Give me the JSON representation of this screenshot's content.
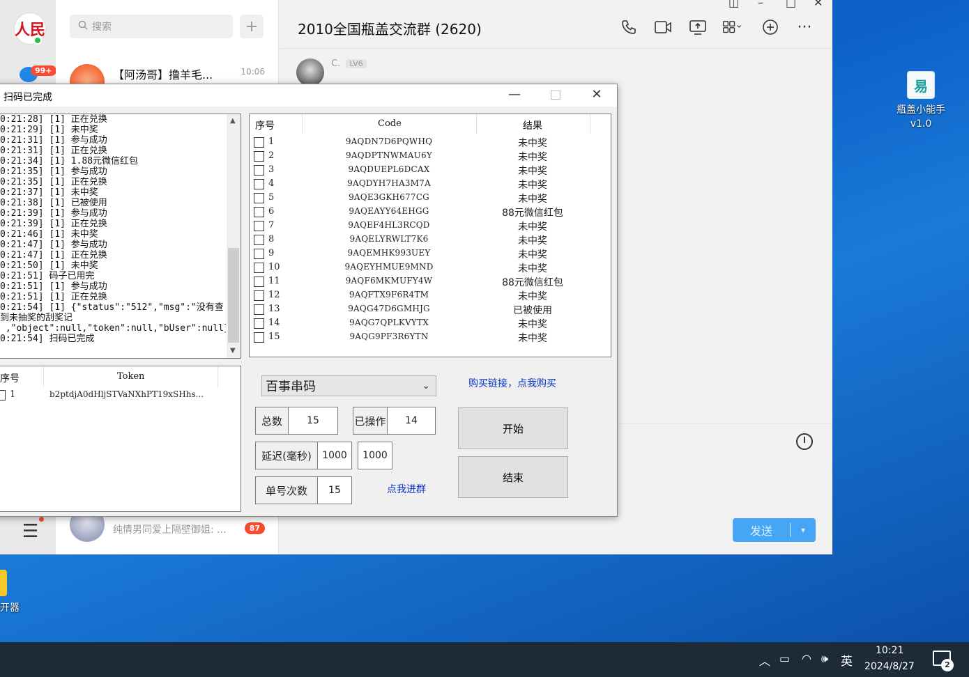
{
  "qq": {
    "avatar_text": "人民",
    "unread_total": "99+",
    "search_placeholder": "搜索",
    "conversations": [
      {
        "name": "【阿汤哥】撸羊毛...",
        "time": "10:06",
        "preview": ""
      },
      {
        "name": "",
        "time": "",
        "preview": "纯情男同爱上隔壁御姐: ...",
        "count": "87"
      }
    ],
    "chat_title": "2010全国瓶盖交流群 (2620)",
    "msg_sender": "C.",
    "msg_level": "LV6",
    "send_label": "发送"
  },
  "dialog": {
    "title": "扫码已完成",
    "log_lines": [
      "0:21:28] [1] 正在兑换",
      "0:21:29] [1] 未中奖",
      "0:21:31] [1] 参与成功",
      "0:21:31] [1] 正在兑换",
      "0:21:34] [1] 1.88元微信红包",
      "0:21:35] [1] 参与成功",
      "0:21:35] [1] 正在兑换",
      "0:21:37] [1] 未中奖",
      "0:21:38] [1] 已被使用",
      "0:21:39] [1] 参与成功",
      "0:21:39] [1] 正在兑换",
      "0:21:46] [1] 未中奖",
      "0:21:47] [1] 参与成功",
      "0:21:47] [1] 正在兑换",
      "0:21:50] [1] 未中奖",
      "0:21:51] 码子已用完",
      "0:21:51] [1] 参与成功",
      "0:21:51] [1] 正在兑换",
      "0:21:54] [1] {\"status\":\"512\",\"msg\":\"没有查",
      "到未抽奖的刮奖记",
      " ,\"object\":null,\"token\":null,\"bUser\":null}",
      "0:21:54] 扫码已完成"
    ],
    "code_table": {
      "headers": [
        "序号",
        "Code",
        "结果"
      ],
      "rows": [
        {
          "no": "1",
          "code": "9AQDN7D6PQWHQ",
          "result": "未中奖"
        },
        {
          "no": "2",
          "code": "9AQDPTNWMAU6Y",
          "result": "未中奖"
        },
        {
          "no": "3",
          "code": "9AQDUEPL6DCAX",
          "result": "未中奖"
        },
        {
          "no": "4",
          "code": "9AQDYH7HA3M7A",
          "result": "未中奖"
        },
        {
          "no": "5",
          "code": "9AQE3GKH677CG",
          "result": "未中奖"
        },
        {
          "no": "6",
          "code": "9AQEAYY64EHGG",
          "result": "88元微信红包"
        },
        {
          "no": "7",
          "code": "9AQEF4HL3RCQD",
          "result": "未中奖"
        },
        {
          "no": "8",
          "code": "9AQELYRWLT7K6",
          "result": "未中奖"
        },
        {
          "no": "9",
          "code": "9AQEMHK993UEY",
          "result": "未中奖"
        },
        {
          "no": "10",
          "code": "9AQEYHMUE9MND",
          "result": "未中奖"
        },
        {
          "no": "11",
          "code": "9AQF6MKMUFY4W",
          "result": "88元微信红包"
        },
        {
          "no": "12",
          "code": "9AQFTX9F6R4TM",
          "result": "未中奖"
        },
        {
          "no": "13",
          "code": "9AQG47D6GMHJG",
          "result": "已被使用"
        },
        {
          "no": "14",
          "code": "9AQG7QPLKVYTX",
          "result": "未中奖"
        },
        {
          "no": "15",
          "code": "9AQG9PF3R6YTN",
          "result": "未中奖"
        }
      ]
    },
    "token_table": {
      "headers": [
        "序号",
        "Token"
      ],
      "rows": [
        {
          "no": "1",
          "token": "b2ptdjA0dHljSTVaNXhPT19xSHhs..."
        }
      ]
    },
    "code_type": "百事串码",
    "buy_link": "购买链接，点我购买",
    "join_link": "点我进群",
    "total_label": "总数",
    "total_value": "15",
    "done_label": "已操作",
    "done_value": "14",
    "delay_label": "延迟(毫秒)",
    "delay_min": "1000",
    "delay_max": "1000",
    "per_code_label": "单号次数",
    "per_code_value": "15",
    "start_label": "开始",
    "stop_label": "结束"
  },
  "desktop": {
    "icon_label_line1": "瓶盖小能手",
    "icon_label_line2": "v1.0",
    "left_icon_label": "开器"
  },
  "taskbar": {
    "ime": "英",
    "time": "10:21",
    "date": "2024/8/27",
    "notification_count": "2"
  }
}
